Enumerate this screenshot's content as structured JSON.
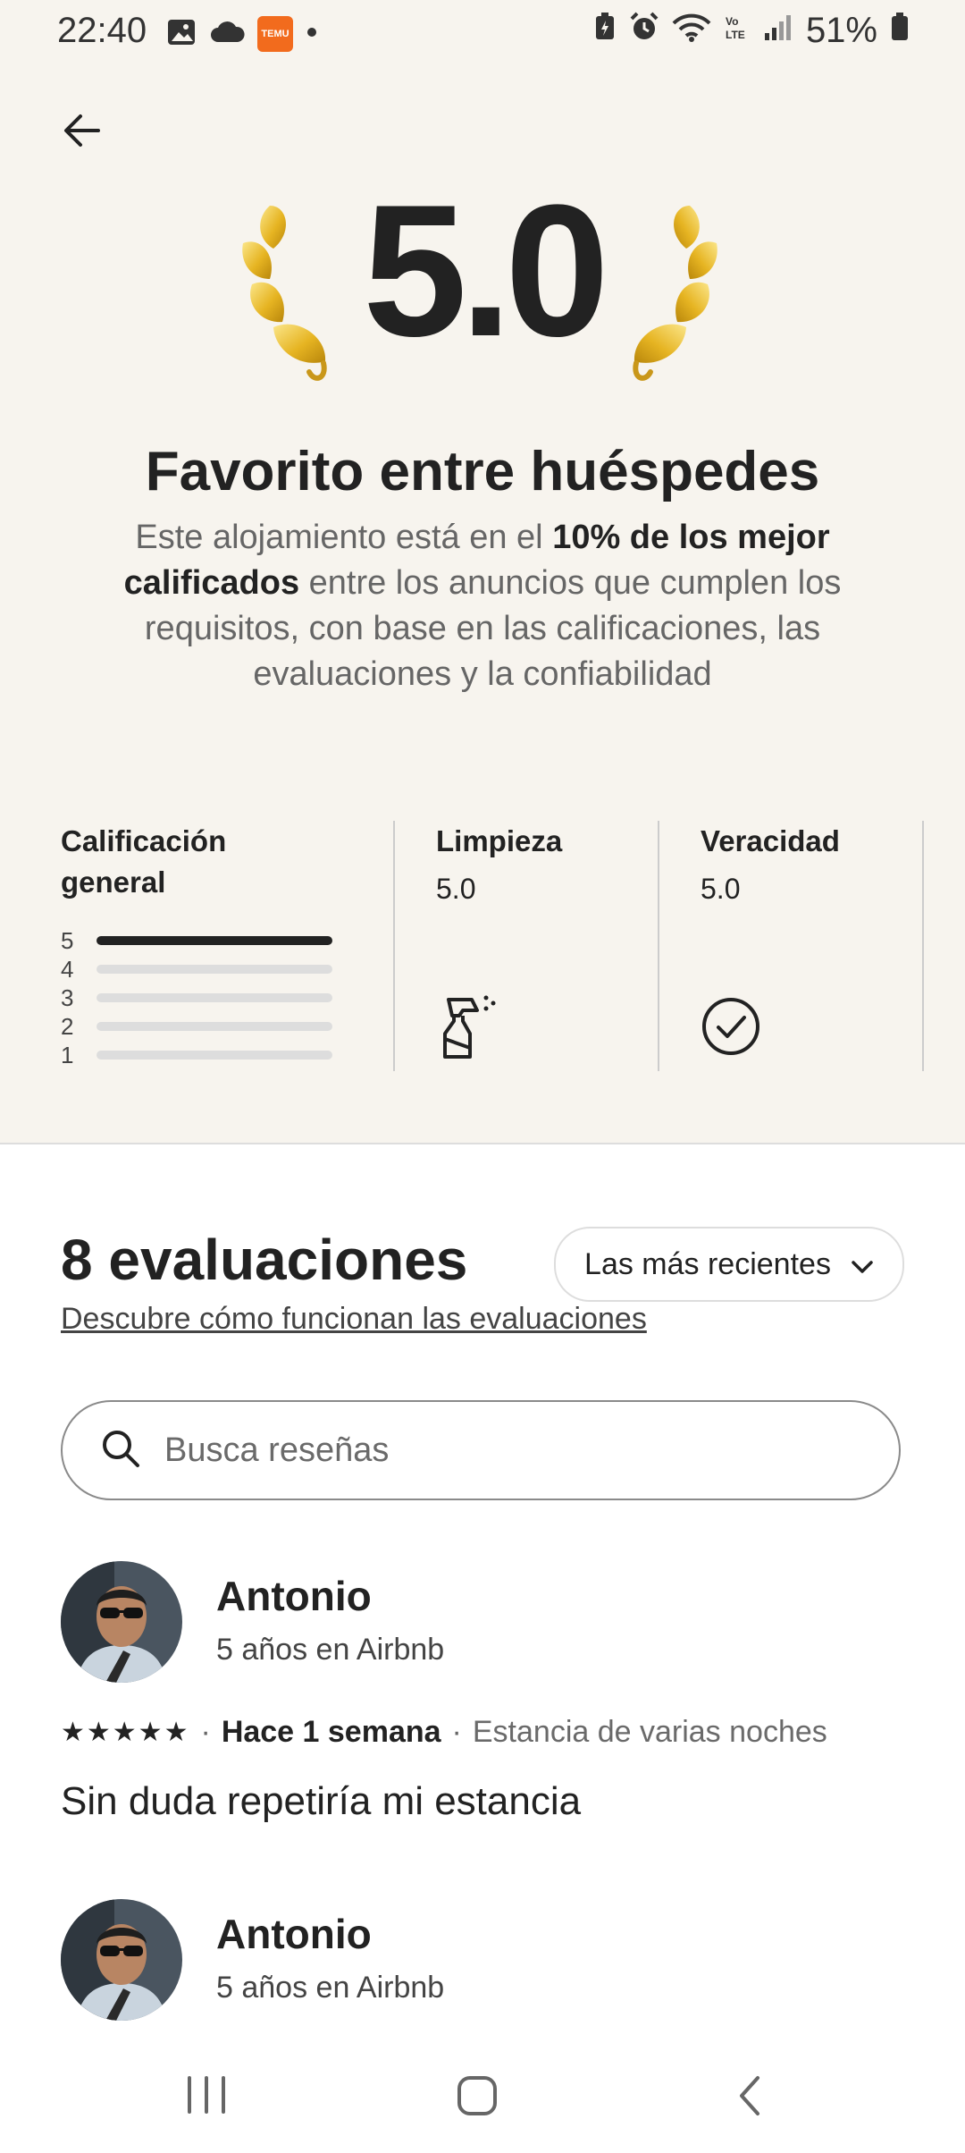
{
  "status_bar": {
    "time": "22:40",
    "battery": "51%",
    "temu_label": "TEMU"
  },
  "highlight": {
    "rating": "5.0",
    "title": "Favorito entre huéspedes",
    "desc_pre": "Este alojamiento está en el ",
    "desc_bold": "10% de los mejor calificados",
    "desc_post": " entre los anuncios que cumplen los requisitos, con base en las calificaciones, las evaluaciones y la confiabilidad"
  },
  "categories": {
    "overall": {
      "label": "Calificación general",
      "distribution": [
        {
          "stars": "5",
          "fraction": 1.0
        },
        {
          "stars": "4",
          "fraction": 0.0
        },
        {
          "stars": "3",
          "fraction": 0.0
        },
        {
          "stars": "2",
          "fraction": 0.0
        },
        {
          "stars": "1",
          "fraction": 0.0
        }
      ]
    },
    "cleanliness": {
      "label": "Limpieza",
      "value": "5.0",
      "icon": "spray-bottle-icon"
    },
    "accuracy": {
      "label": "Veracidad",
      "value": "5.0",
      "icon": "check-circle-icon"
    }
  },
  "reviews_section": {
    "count_label": "8 evaluaciones",
    "sort_label": "Las más recientes",
    "learn_link": "Descubre cómo funcionan las evaluaciones",
    "search_placeholder": "Busca reseñas"
  },
  "reviews": [
    {
      "name": "Antonio",
      "tenure": "5 años en Airbnb",
      "stars": "★★★★★",
      "rating": 5,
      "when": "Hace 1 semana",
      "stay": "Estancia de varias noches",
      "text": "Sin duda repetiría mi estancia"
    },
    {
      "name": "Antonio",
      "tenure": "5 años en Airbnb"
    }
  ],
  "colors": {
    "background_top": "#f7f4ee",
    "text_primary": "#222222",
    "text_secondary": "#6a6a6a",
    "laurel_gold": "#e6b422"
  }
}
